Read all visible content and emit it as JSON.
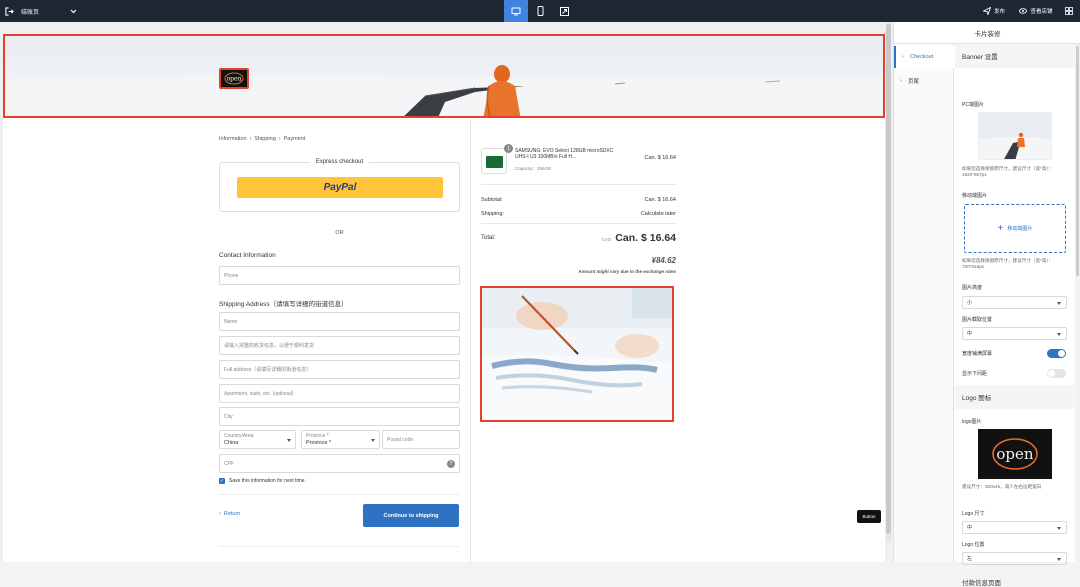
{
  "topbar": {
    "page_name": "结账页",
    "publish_label": "发布",
    "view_store_label": "查看店铺"
  },
  "banner": {
    "logo_text": "open"
  },
  "checkout": {
    "breadcrumb": [
      "Information",
      "Shipping",
      "Payment"
    ],
    "express_title": "Express checkout",
    "paypal_label": "PayPal",
    "or_label": "OR",
    "contact_title": "Contact Information",
    "phone_placeholder": "Phone",
    "shipping_title": "Shipping Address（请填写详细的街道信息）",
    "name_placeholder": "Name",
    "detail_placeholder": "请输入完整的收货信息，以便于顺利发货",
    "full_address_placeholder": "Full address（请填写详细的街道信息）",
    "apartment_placeholder": "Apartment, suite, etc. (optional)",
    "city_placeholder": "City",
    "country_label": "Country/Area",
    "country_value": "China",
    "province_label": "Province *",
    "province_value": "Province *",
    "postal_placeholder": "Postal code",
    "cpf_placeholder": "CPF",
    "help_icon": "?",
    "save_info_label": "Save this information for next time.",
    "return_label": "Return",
    "continue_label": "Continue to shipping"
  },
  "summary": {
    "product_name": "SAMSUNG: EVO Select 128GB microSDXC UHS-I U3 100MB/s Full H...",
    "product_variant": "Capacity：256GB",
    "product_qty": "1",
    "product_price": "Can. $ 16.64",
    "subtotal_label": "Subtotal:",
    "subtotal_value": "Can. $ 16.64",
    "shipping_label": "Shipping:",
    "shipping_value": "Calculate later",
    "total_label": "Total:",
    "total_currency": "CAD",
    "total_value": "Can. $ 16.64",
    "total_yen": "¥84.62",
    "exchange_note": "Amount might vary due to the exchange rates"
  },
  "floating_button_label": "Button",
  "panel": {
    "title": "卡片装修",
    "tabs": [
      "Checkout",
      "页尾"
    ],
    "banner_section": "Banner 设置",
    "pc_image_label": "PC端图片",
    "pc_hint": "如果您选择保留原尺寸，建议尺寸（宽*高）：1920*667px",
    "mobile_image_label": "移动端图片",
    "upload_label": "移动端图片",
    "mobile_hint": "如果您选择保留原尺寸，建议尺寸（宽*高）：750*916px",
    "image_height_label": "图片高度",
    "image_height_value": "小",
    "image_crop_label": "图片截取位置",
    "image_crop_value": "中",
    "full_width_label": "宽度铺满屏幕",
    "show_divider_label": "显示下间距",
    "logo_section": "Logo 图标",
    "logo_image_label": "logo图片",
    "logo_text": "open",
    "logo_hint": "建议尺寸：300x45，减少左右边距留白",
    "logo_size_label": "Logo 尺寸",
    "logo_size_value": "中",
    "logo_position_label": "Logo 位置",
    "logo_position_value": "左",
    "next_section": "付款信息页面"
  },
  "colors": {
    "accent": "#2f72c4",
    "highlight": "#e3402e",
    "topbar": "#1e2633",
    "paypal": "#ffc439"
  }
}
